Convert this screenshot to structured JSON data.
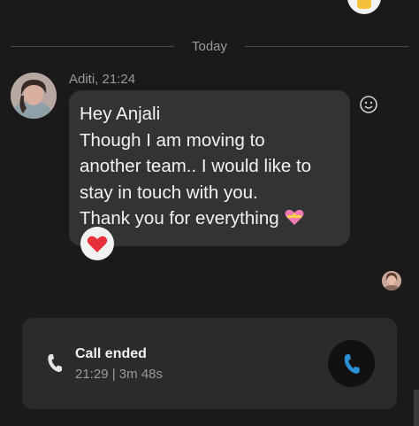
{
  "divider": {
    "label": "Today"
  },
  "message": {
    "sender": "Aditi, 21:24",
    "lines": [
      "Hey Anjali",
      "Though I am moving to",
      "another team.. I would like to",
      "stay in touch with you.",
      "Thank you for everything"
    ],
    "emoji": "heart-with-ribbon-icon",
    "reaction": "red-heart-icon"
  },
  "call": {
    "title": "Call ended",
    "meta": "21:29 | 3m 48s"
  },
  "colors": {
    "background": "#1a1a1a",
    "bubble": "#333333",
    "card": "#2b2b2b",
    "call_blue": "#2b8fd6",
    "heart_red": "#e8303a"
  }
}
